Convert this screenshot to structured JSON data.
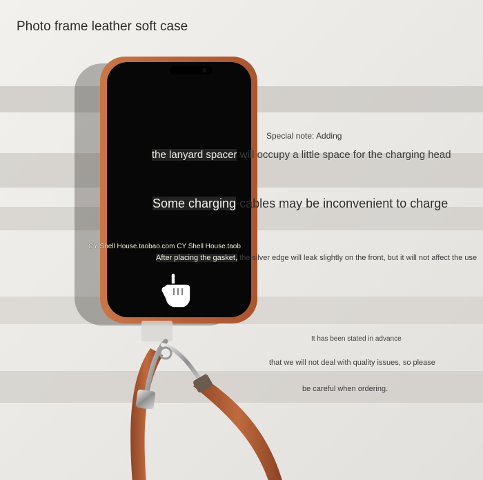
{
  "title": "Photo frame leather soft case",
  "notes": {
    "heading": "Special note: Adding",
    "line1_highlight": "the lanyard spacer",
    "line1_rest": " will occupy a little space for the charging head",
    "line2_highlight": "Some charging",
    "line2_rest": " cables may be inconvenient to charge",
    "watermark": "CY Shell House.taobao.com CY Shell House.taob",
    "gasket_highlight": "After placing the gasket,",
    "gasket_rest": " the silver edge will leak slightly on the front, but it will not affect the use"
  },
  "advance": {
    "line1": "It has been stated in advance",
    "line2": "that we will not deal with quality issues, so please",
    "line3": "be careful when ordering."
  },
  "colors": {
    "case": "#b8643a",
    "screen": "#070707",
    "background": "#eceae6"
  },
  "icons": [
    "pointing-hand-icon",
    "carabiner-clip-icon"
  ]
}
